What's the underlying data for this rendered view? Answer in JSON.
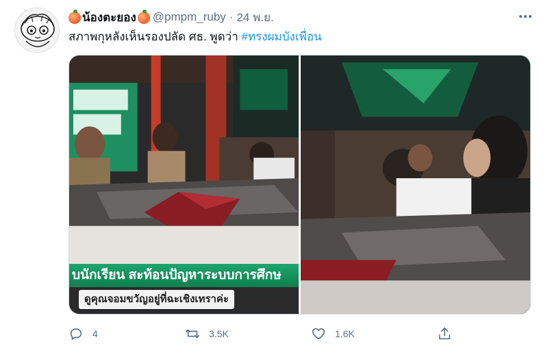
{
  "tweet": {
    "author": {
      "display_name": "น้องตะยอง",
      "handle": "@pmpm_ruby",
      "avatar_icon": "cartoon-avatar-icon",
      "emoji_icon": "peach-emoji-icon"
    },
    "separator": "·",
    "time": "24 พ.ย.",
    "text": "สภาพกุหลังเห็นรองปลัด ศธ. พูดว่า ",
    "hashtag": "#ทรงผมบังเพื่อน",
    "media": {
      "ticker_text": "บนักเรียน สะท้อนปัญหาระบบการศึกษ",
      "caption_text": "ดูคุณจอมขวัญอยู่ที่ฉะเชิงเทราค่ะ"
    },
    "actions": {
      "reply_count": "4",
      "retweet_count": "3.5K",
      "like_count": "1.6K"
    },
    "colors": {
      "hashtag": "#1b95e0",
      "secondary_text": "#5b7083",
      "ticker_green": "#0d7f4e"
    }
  }
}
